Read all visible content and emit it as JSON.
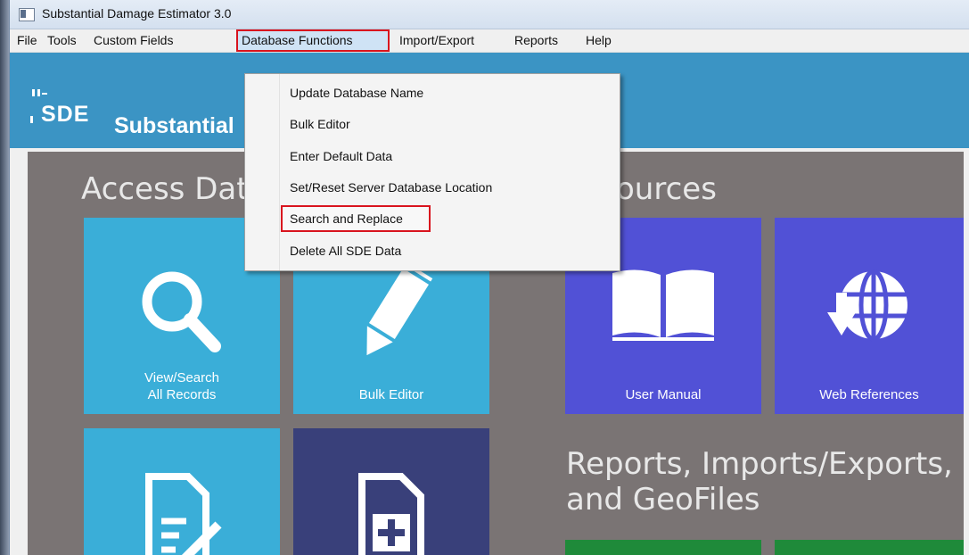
{
  "window": {
    "title": "Substantial Damage Estimator 3.0"
  },
  "menubar": {
    "items": [
      {
        "label": "File"
      },
      {
        "label": "Tools"
      },
      {
        "label": "Custom Fields"
      },
      {
        "label": "Database Functions"
      },
      {
        "label": "Import/Export"
      },
      {
        "label": "Reports"
      },
      {
        "label": "Help"
      }
    ]
  },
  "header": {
    "logo_text": "SDE",
    "app_name": "Substantial"
  },
  "dropdown": {
    "items": [
      {
        "label": "Update Database Name"
      },
      {
        "label": "Bulk Editor"
      },
      {
        "label": "Enter Default Data"
      },
      {
        "label": "Set/Reset Server Database Location"
      },
      {
        "label": "Search and Replace"
      },
      {
        "label": "Delete All SDE Data"
      }
    ]
  },
  "sections": {
    "access_title": "Access Dat",
    "resources_title": "ources",
    "reports_title_line1": "Reports, Imports/Exports,",
    "reports_title_line2": "and GeoFiles"
  },
  "tiles": {
    "view_search_line1": "View/Search",
    "view_search_line2": "All Records",
    "bulk_editor": "Bulk Editor",
    "user_manual": "User Manual",
    "web_references": "Web References"
  },
  "colors": {
    "header_blue": "#3b94c4",
    "tile_cyan": "#3aaed8",
    "tile_indigo": "#5151d6",
    "tile_navy": "#39407a",
    "tile_green": "#1f8a3a",
    "content_gray": "#7a7474",
    "highlight_red": "#d9141e"
  }
}
